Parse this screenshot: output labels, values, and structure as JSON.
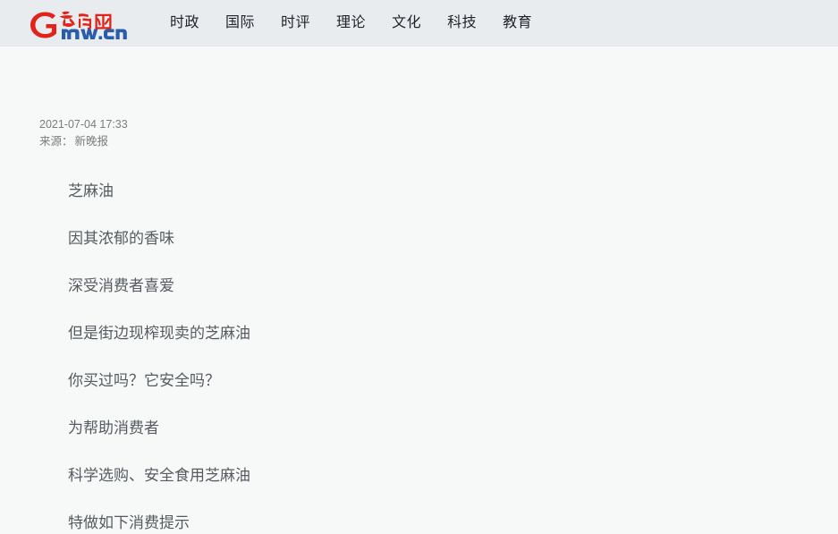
{
  "header": {
    "logo": {
      "brand_cn": "光明网",
      "brand_domain": "mw.cn",
      "mark_letter": "G",
      "red": "#e2231a",
      "blue": "#2a5caa"
    },
    "nav": [
      {
        "label": "时政"
      },
      {
        "label": "国际"
      },
      {
        "label": "时评"
      },
      {
        "label": "理论"
      },
      {
        "label": "文化"
      },
      {
        "label": "科技"
      },
      {
        "label": "教育"
      }
    ]
  },
  "article": {
    "datetime": "2021-07-04 17:33",
    "source_label": "来源：",
    "source_name": "新晚报",
    "paragraphs": [
      {
        "text": "芝麻油"
      },
      {
        "text": "因其浓郁的香味"
      },
      {
        "text": "深受消费者喜爱"
      },
      {
        "text": "但是街边现榨现卖的芝麻油"
      },
      {
        "text": "你买过吗？它安全吗？"
      },
      {
        "text": "为帮助消费者"
      },
      {
        "text": "科学选购、安全食用芝麻油"
      },
      {
        "text": "特做如下消费提示"
      }
    ]
  },
  "colors": {
    "header_bg": "#e8ecef",
    "page_bg": "#f7f9f8",
    "nav_text": "#20252c",
    "meta_text": "#7b7b7b",
    "body_text": "#555b60"
  }
}
